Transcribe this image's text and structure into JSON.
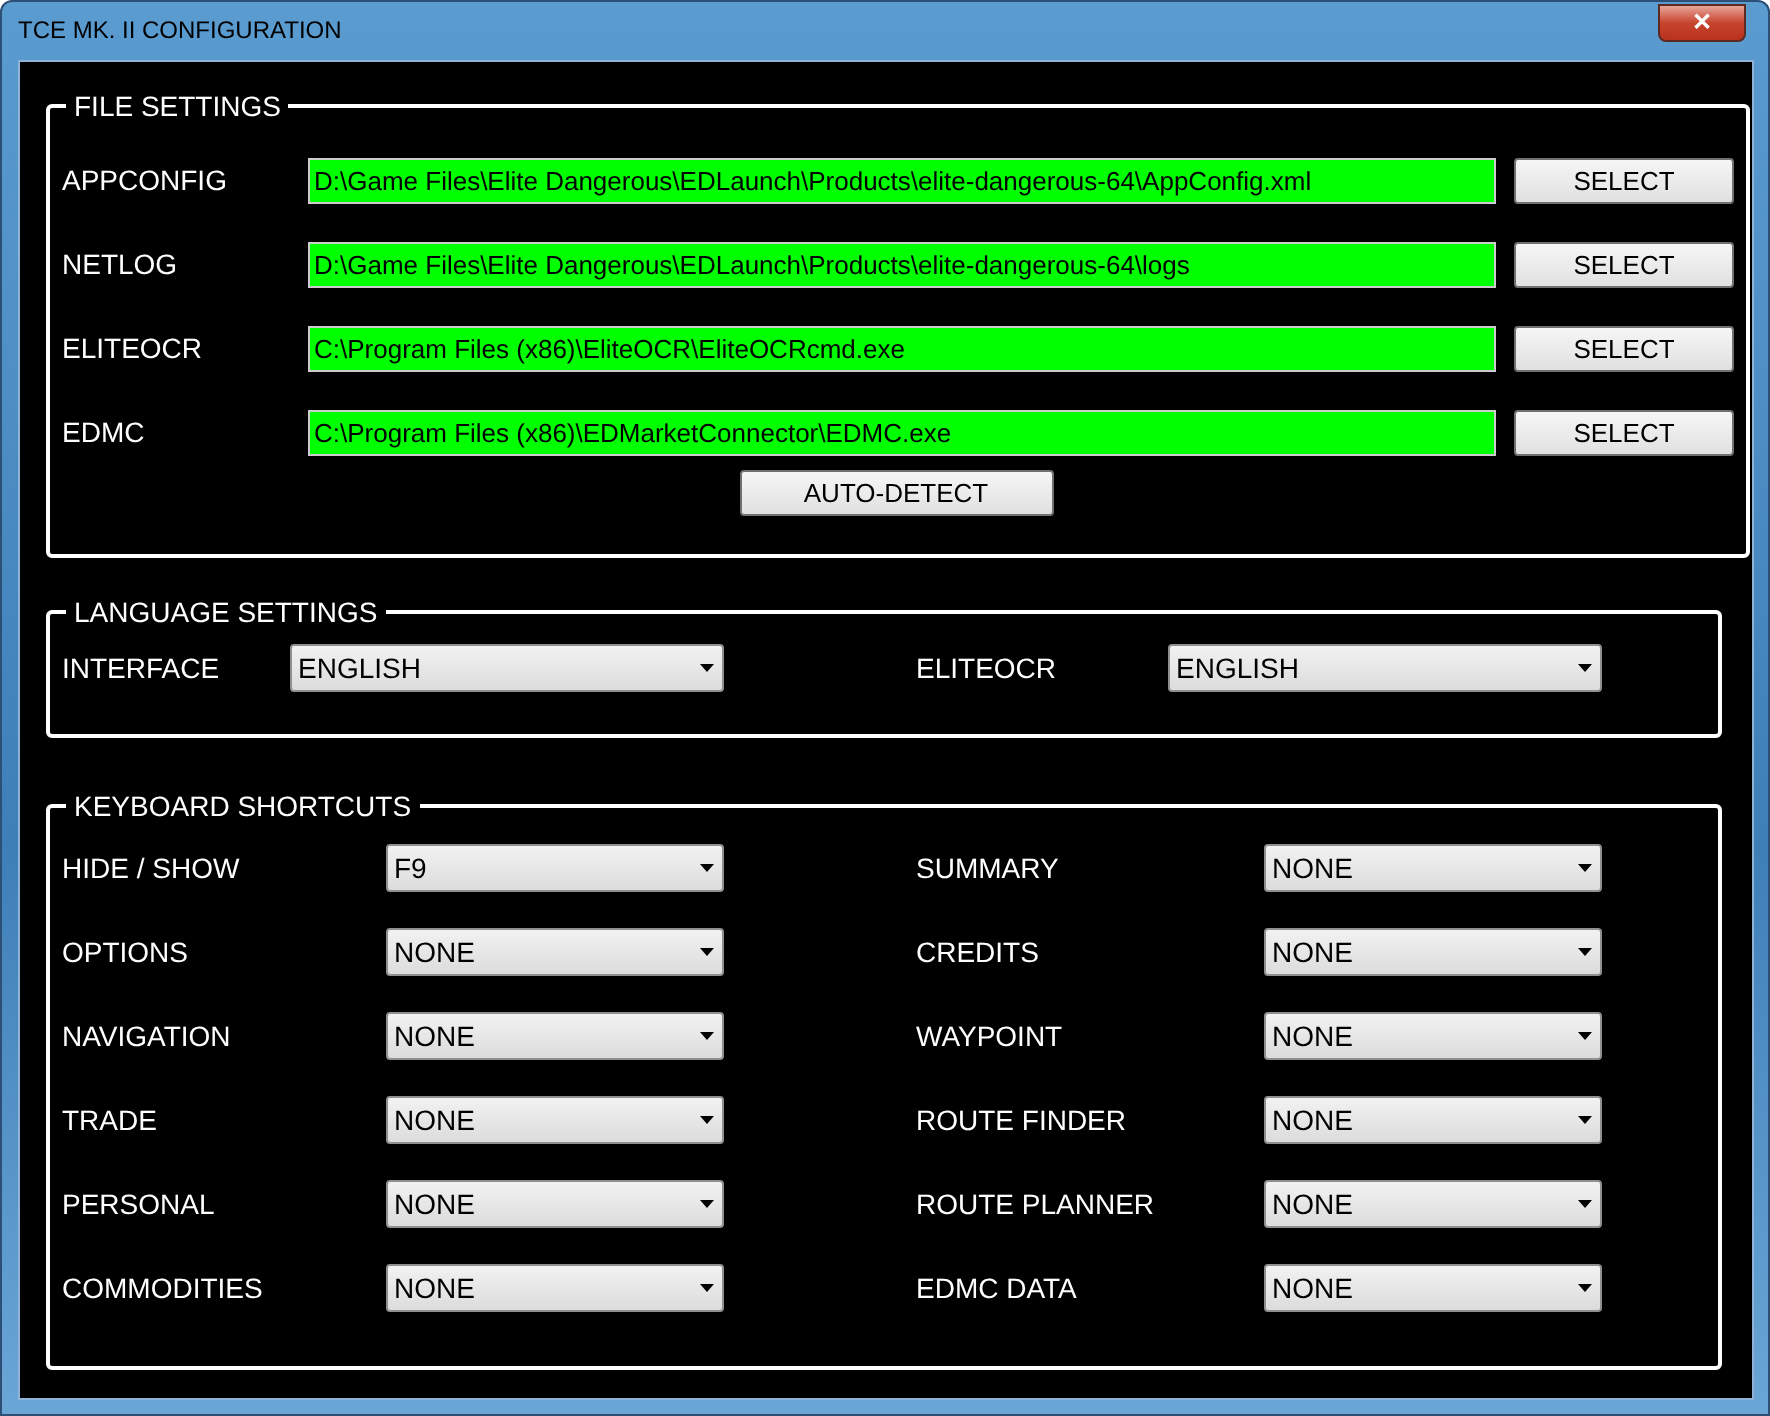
{
  "window": {
    "title": "TCE MK. II CONFIGURATION",
    "close": "✕"
  },
  "file_settings": {
    "title": "FILE SETTINGS",
    "rows": [
      {
        "label": "APPCONFIG",
        "value": "D:\\Game Files\\Elite Dangerous\\EDLaunch\\Products\\elite-dangerous-64\\AppConfig.xml",
        "button": "SELECT"
      },
      {
        "label": "NETLOG",
        "value": "D:\\Game Files\\Elite Dangerous\\EDLaunch\\Products\\elite-dangerous-64\\logs",
        "button": "SELECT"
      },
      {
        "label": "ELITEOCR",
        "value": "C:\\Program Files (x86)\\EliteOCR\\EliteOCRcmd.exe",
        "button": "SELECT"
      },
      {
        "label": "EDMC",
        "value": "C:\\Program Files (x86)\\EDMarketConnector\\EDMC.exe",
        "button": "SELECT"
      }
    ],
    "auto_detect": "AUTO-DETECT"
  },
  "language_settings": {
    "title": "LANGUAGE SETTINGS",
    "items": [
      {
        "label": "INTERFACE",
        "value": "ENGLISH"
      },
      {
        "label": "ELITEOCR",
        "value": "ENGLISH"
      }
    ]
  },
  "keyboard_shortcuts": {
    "title": "KEYBOARD SHORTCUTS",
    "items": [
      {
        "label": "HIDE / SHOW",
        "value": "F9"
      },
      {
        "label": "SUMMARY",
        "value": "NONE"
      },
      {
        "label": "OPTIONS",
        "value": "NONE"
      },
      {
        "label": "CREDITS",
        "value": "NONE"
      },
      {
        "label": "NAVIGATION",
        "value": "NONE"
      },
      {
        "label": "WAYPOINT",
        "value": "NONE"
      },
      {
        "label": "TRADE",
        "value": "NONE"
      },
      {
        "label": "ROUTE FINDER",
        "value": "NONE"
      },
      {
        "label": "PERSONAL",
        "value": "NONE"
      },
      {
        "label": "ROUTE PLANNER",
        "value": "NONE"
      },
      {
        "label": "COMMODITIES",
        "value": "NONE"
      },
      {
        "label": "EDMC DATA",
        "value": "NONE"
      }
    ]
  }
}
